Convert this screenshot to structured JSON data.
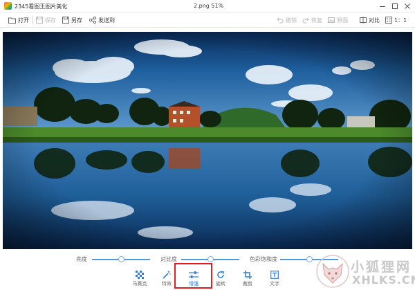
{
  "window": {
    "app_title": "2345看图王图片美化",
    "file_title": "2.png  51%"
  },
  "toolbar": {
    "open": "打开",
    "save": "保存",
    "save_as": "另存",
    "send_to": "发送到",
    "undo": "撤销",
    "redo": "恢复",
    "original": "原图",
    "compare": "对比",
    "ratio": "1：1"
  },
  "adjust": {
    "brightness_label": "亮度",
    "contrast_label": "对比度",
    "saturation_label": "色彩饱和度",
    "brightness_value": 0.5,
    "contrast_value": 0.5,
    "saturation_value": 0.5
  },
  "tools": [
    {
      "label": "马赛克",
      "icon": "mosaic-icon"
    },
    {
      "label": "特效",
      "icon": "magic-wand-icon"
    },
    {
      "label": "增强",
      "icon": "sliders-icon"
    },
    {
      "label": "旋转",
      "icon": "rotate-icon"
    },
    {
      "label": "裁剪",
      "icon": "crop-icon"
    },
    {
      "label": "文字",
      "icon": "text-icon"
    }
  ],
  "active_tool": "增强",
  "watermark": {
    "cn": "小狐狸网",
    "en": "XHLKS.CN"
  },
  "colors": {
    "accent": "#2f7de1",
    "highlight_frame": "#e02020",
    "disabled": "#b9b9b9"
  }
}
